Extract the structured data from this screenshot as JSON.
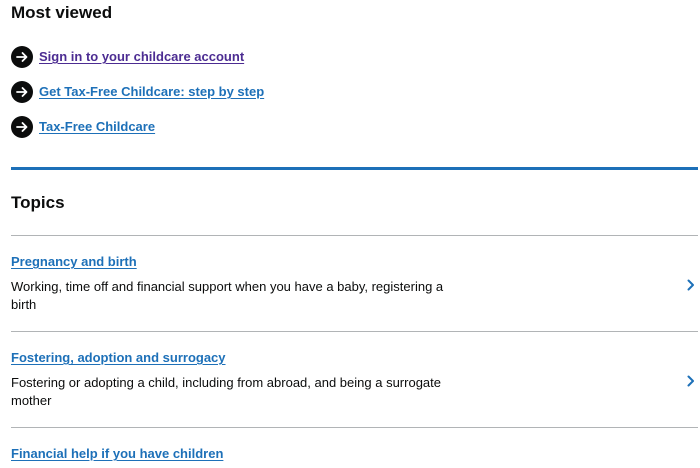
{
  "most_viewed": {
    "heading": "Most viewed",
    "items": [
      {
        "label": "Sign in to your childcare account",
        "visited": true
      },
      {
        "label": "Get Tax-Free Childcare: step by step",
        "visited": false
      },
      {
        "label": "Tax-Free Childcare",
        "visited": false
      }
    ]
  },
  "topics": {
    "heading": "Topics",
    "items": [
      {
        "title": "Pregnancy and birth",
        "description": "Working, time off and financial support when you have a baby, registering a birth"
      },
      {
        "title": "Fostering, adoption and surrogacy",
        "description": "Fostering or adopting a child, including from abroad, and being a surrogate mother"
      },
      {
        "title": "Financial help if you have children"
      }
    ]
  },
  "icons": {
    "most_viewed_item": "arrow-right-circle-icon",
    "topic_item": "chevron-right-icon"
  },
  "colors": {
    "text": "#0b0c0c",
    "link": "#1d70b8",
    "visited_link": "#4c2c92",
    "border": "#b1b4b6"
  }
}
